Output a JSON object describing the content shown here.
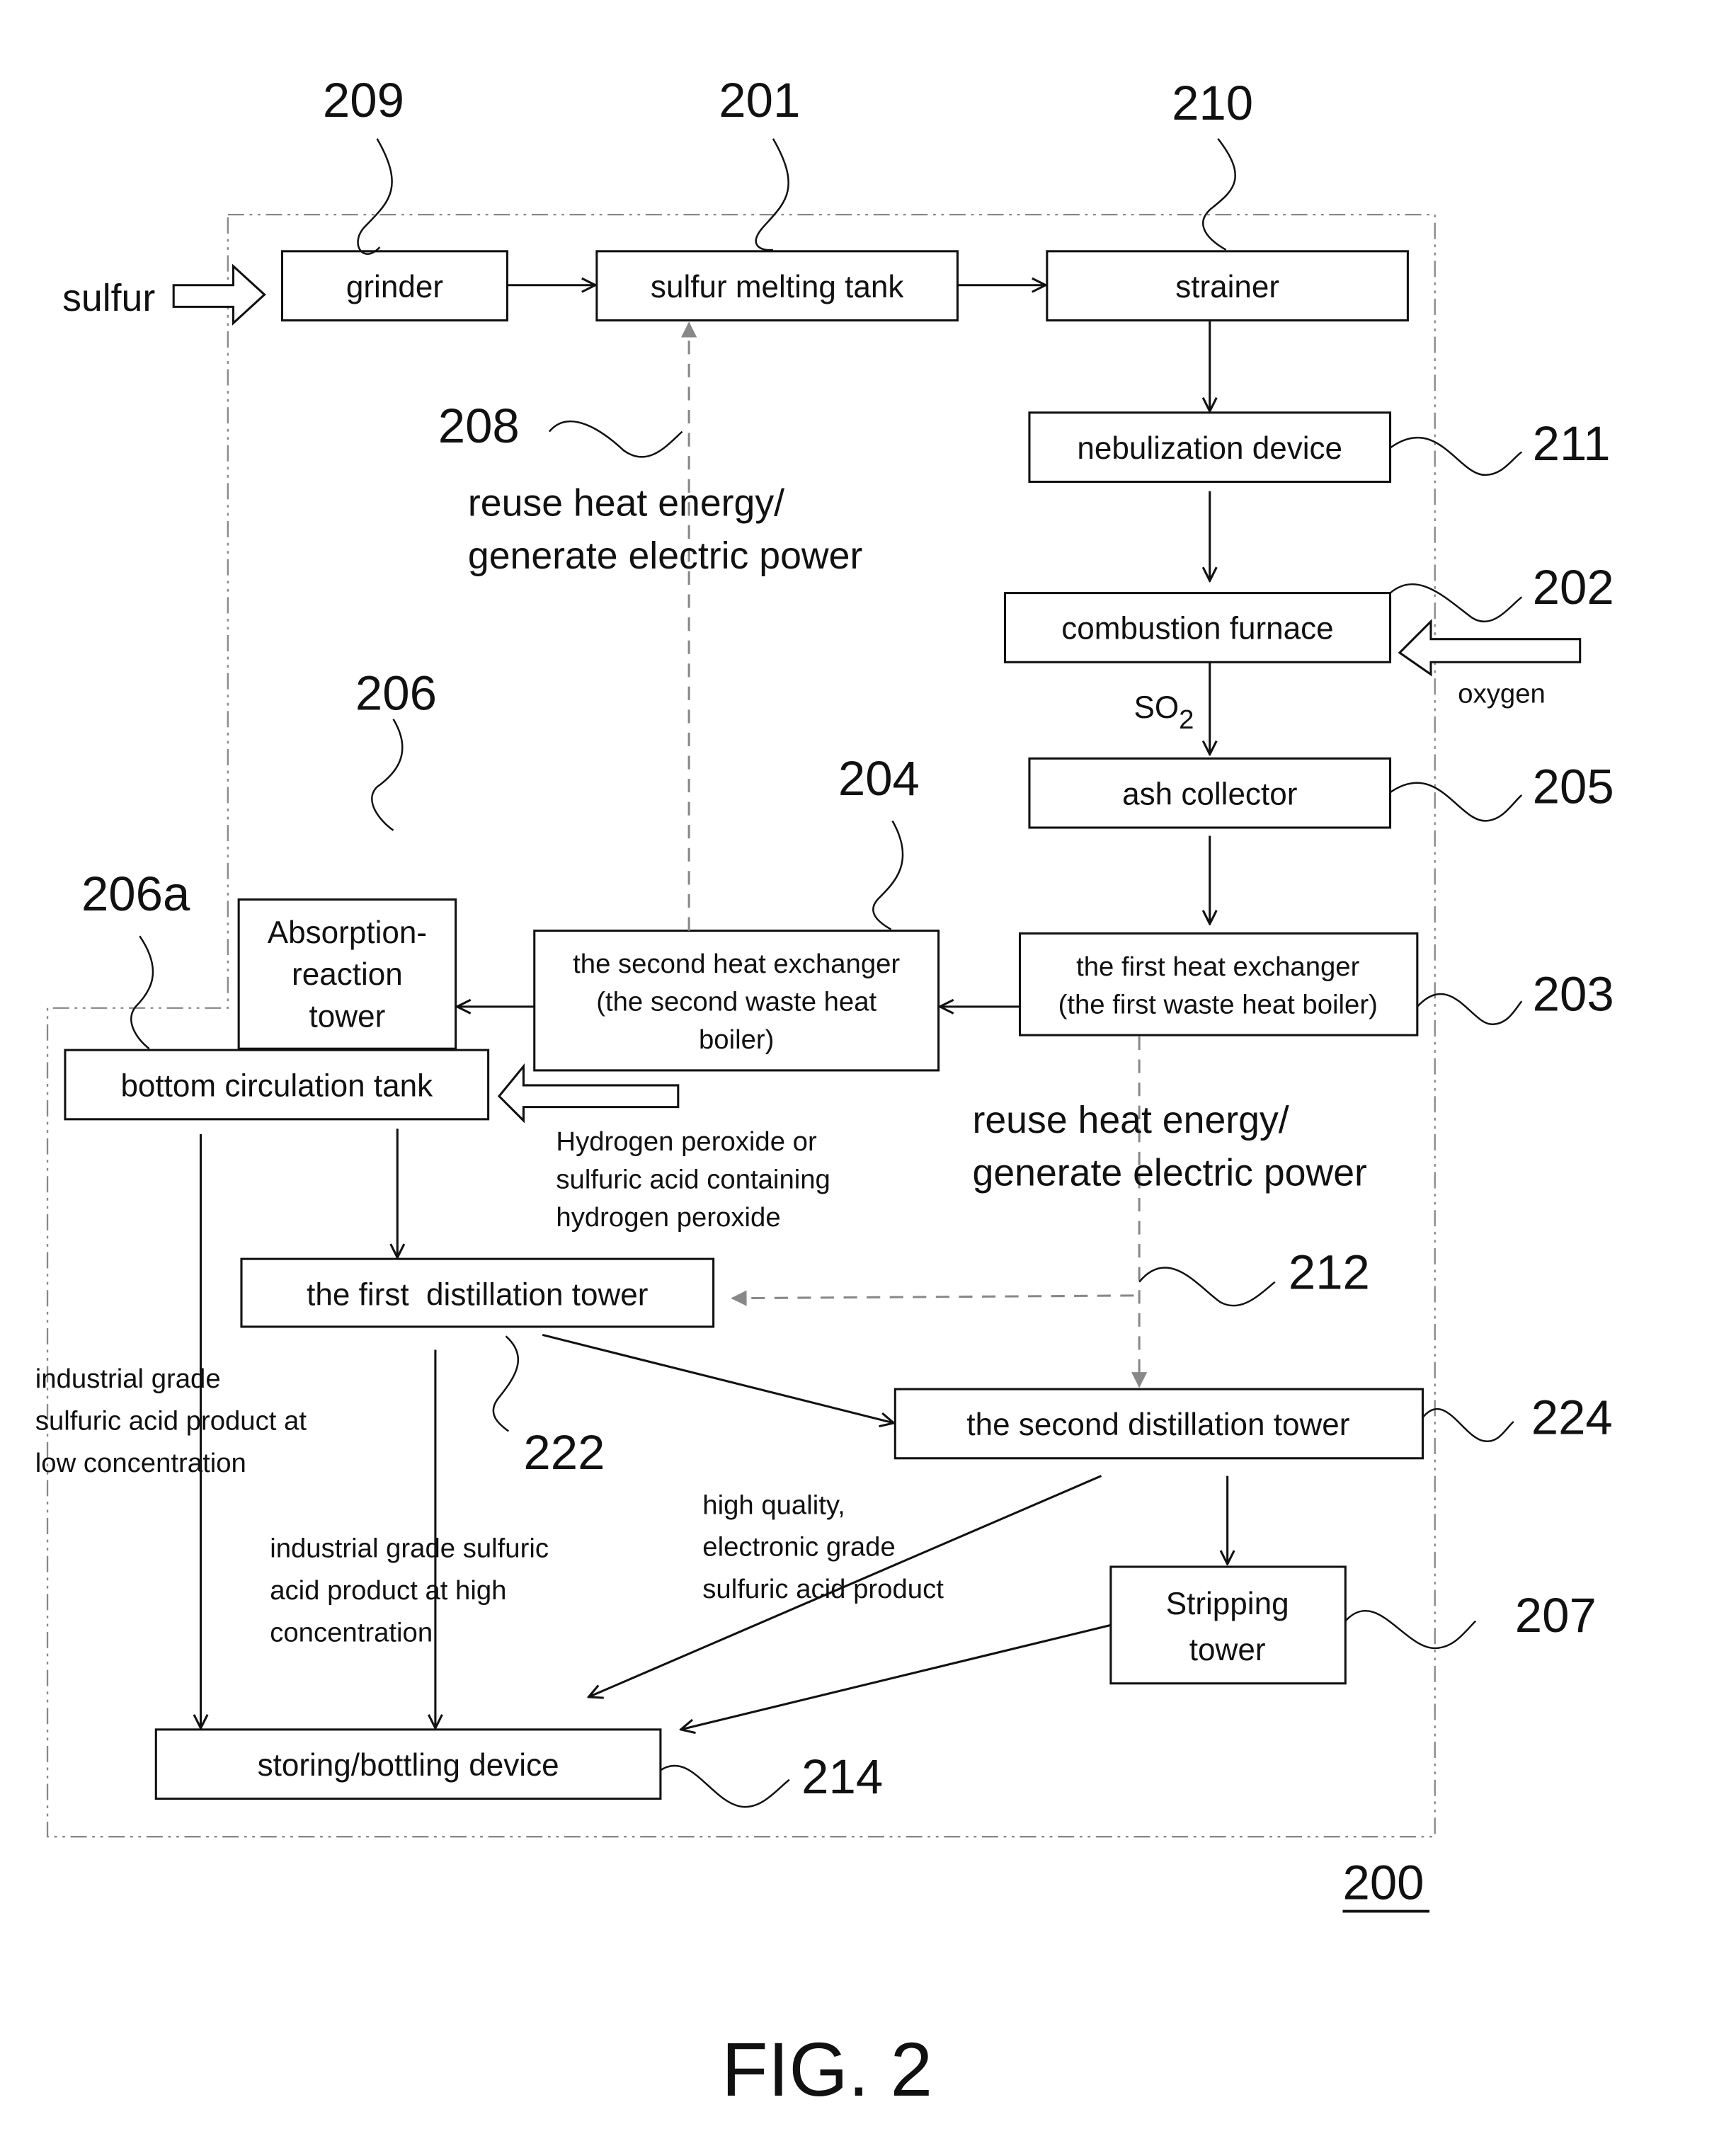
{
  "figure": {
    "title": "FIG. 2",
    "system_ref": "200"
  },
  "inputs": {
    "sulfur": "sulfur",
    "oxygen": "oxygen",
    "peroxide": [
      "Hydrogen peroxide or",
      "sulfuric acid containing",
      "hydrogen peroxide"
    ]
  },
  "boxes": {
    "grinder": {
      "label": [
        "grinder"
      ],
      "ref": "209"
    },
    "melting_tank": {
      "label": [
        "sulfur melting tank"
      ],
      "ref": "201"
    },
    "strainer": {
      "label": [
        "strainer"
      ],
      "ref": "210"
    },
    "nebulization": {
      "label": [
        "nebulization device"
      ],
      "ref": "211"
    },
    "furnace": {
      "label": [
        "combustion furnace"
      ],
      "ref": "202"
    },
    "ash_collector": {
      "label": [
        "ash collector"
      ],
      "ref": "205"
    },
    "first_hx": {
      "label": [
        "the first heat exchanger",
        "(the first waste heat boiler)"
      ],
      "ref": "203"
    },
    "second_hx": {
      "label": [
        "the second heat exchanger",
        "(the second waste heat",
        "boiler)"
      ],
      "ref": "204"
    },
    "absorption_tower": {
      "label": [
        "Absorption-",
        "reaction",
        "tower"
      ],
      "ref": "206"
    },
    "bottom_tank": {
      "label": [
        "bottom circulation tank"
      ],
      "ref": "206a"
    },
    "first_distillation": {
      "label": [
        "the first  distillation tower"
      ],
      "ref": "222"
    },
    "second_distillation": {
      "label": [
        "the second distillation tower"
      ],
      "ref": "224"
    },
    "stripping_tower": {
      "label": [
        "Stripping",
        "tower"
      ],
      "ref": "207"
    },
    "storing": {
      "label": [
        "storing/bottling device"
      ],
      "ref": "214"
    }
  },
  "flows": {
    "so2": {
      "main": "SO",
      "sub": "2"
    },
    "heat_reuse_top": {
      "lines": [
        "reuse heat energy/",
        "generate electric power"
      ],
      "ref": "208"
    },
    "heat_reuse_mid": {
      "lines": [
        "reuse heat energy/",
        "generate electric power"
      ],
      "ref": "212"
    },
    "low_conc": [
      "industrial grade",
      "sulfuric acid product at",
      "low concentration"
    ],
    "high_conc": [
      "industrial grade sulfuric",
      "acid product at high",
      "concentration"
    ],
    "electronic": [
      "high quality,",
      "electronic grade",
      "sulfuric acid product"
    ]
  }
}
